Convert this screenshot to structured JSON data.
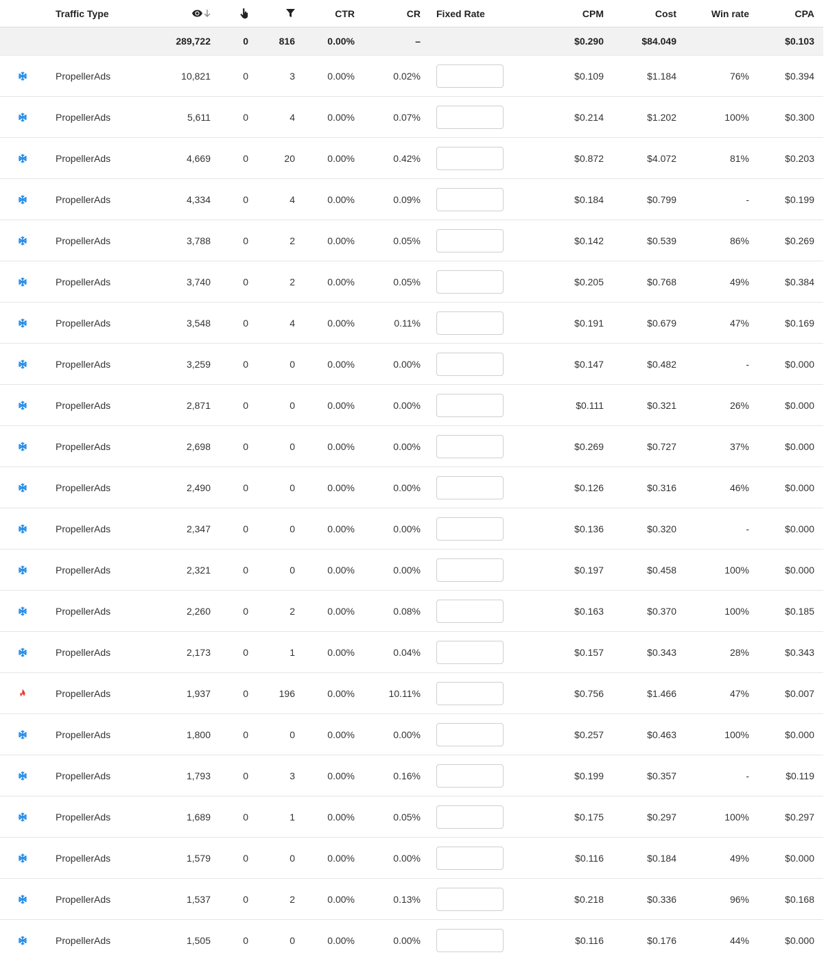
{
  "colors": {
    "snowflake": "#1e88e5",
    "fire": "#e53935",
    "total_bg": "#f2f2f2",
    "border": "#e6e6e6"
  },
  "header": {
    "traffic_type": "Traffic Type",
    "impressions_icon": "eye-icon",
    "sort_icon": "arrow-down-icon",
    "clicks_icon": "pointer-hand-icon",
    "conversions_icon": "funnel-icon",
    "ctr": "CTR",
    "cr": "CR",
    "fixed_rate": "Fixed Rate",
    "cpm": "CPM",
    "cost": "Cost",
    "win_rate": "Win rate",
    "cpa": "CPA"
  },
  "totals": {
    "impressions": "289,722",
    "clicks": "0",
    "conversions": "816",
    "ctr": "0.00%",
    "cr": "–",
    "cpm": "$0.290",
    "cost": "$84.049",
    "cpa": "$0.103"
  },
  "rows": [
    {
      "icon": "snowflake-icon",
      "type": "PropellerAds",
      "impressions": "10,821",
      "clicks": "0",
      "conversions": "3",
      "ctr": "0.00%",
      "cr": "0.02%",
      "fixed_rate": "",
      "cpm": "$0.109",
      "cost": "$1.184",
      "win_rate": "76%",
      "cpa": "$0.394"
    },
    {
      "icon": "snowflake-icon",
      "type": "PropellerAds",
      "impressions": "5,611",
      "clicks": "0",
      "conversions": "4",
      "ctr": "0.00%",
      "cr": "0.07%",
      "fixed_rate": "",
      "cpm": "$0.214",
      "cost": "$1.202",
      "win_rate": "100%",
      "cpa": "$0.300"
    },
    {
      "icon": "snowflake-icon",
      "type": "PropellerAds",
      "impressions": "4,669",
      "clicks": "0",
      "conversions": "20",
      "ctr": "0.00%",
      "cr": "0.42%",
      "fixed_rate": "",
      "cpm": "$0.872",
      "cost": "$4.072",
      "win_rate": "81%",
      "cpa": "$0.203"
    },
    {
      "icon": "snowflake-icon",
      "type": "PropellerAds",
      "impressions": "4,334",
      "clicks": "0",
      "conversions": "4",
      "ctr": "0.00%",
      "cr": "0.09%",
      "fixed_rate": "",
      "cpm": "$0.184",
      "cost": "$0.799",
      "win_rate": "-",
      "cpa": "$0.199"
    },
    {
      "icon": "snowflake-icon",
      "type": "PropellerAds",
      "impressions": "3,788",
      "clicks": "0",
      "conversions": "2",
      "ctr": "0.00%",
      "cr": "0.05%",
      "fixed_rate": "",
      "cpm": "$0.142",
      "cost": "$0.539",
      "win_rate": "86%",
      "cpa": "$0.269"
    },
    {
      "icon": "snowflake-icon",
      "type": "PropellerAds",
      "impressions": "3,740",
      "clicks": "0",
      "conversions": "2",
      "ctr": "0.00%",
      "cr": "0.05%",
      "fixed_rate": "",
      "cpm": "$0.205",
      "cost": "$0.768",
      "win_rate": "49%",
      "cpa": "$0.384"
    },
    {
      "icon": "snowflake-icon",
      "type": "PropellerAds",
      "impressions": "3,548",
      "clicks": "0",
      "conversions": "4",
      "ctr": "0.00%",
      "cr": "0.11%",
      "fixed_rate": "",
      "cpm": "$0.191",
      "cost": "$0.679",
      "win_rate": "47%",
      "cpa": "$0.169"
    },
    {
      "icon": "snowflake-icon",
      "type": "PropellerAds",
      "impressions": "3,259",
      "clicks": "0",
      "conversions": "0",
      "ctr": "0.00%",
      "cr": "0.00%",
      "fixed_rate": "",
      "cpm": "$0.147",
      "cost": "$0.482",
      "win_rate": "-",
      "cpa": "$0.000"
    },
    {
      "icon": "snowflake-icon",
      "type": "PropellerAds",
      "impressions": "2,871",
      "clicks": "0",
      "conversions": "0",
      "ctr": "0.00%",
      "cr": "0.00%",
      "fixed_rate": "",
      "cpm": "$0.111",
      "cost": "$0.321",
      "win_rate": "26%",
      "cpa": "$0.000"
    },
    {
      "icon": "snowflake-icon",
      "type": "PropellerAds",
      "impressions": "2,698",
      "clicks": "0",
      "conversions": "0",
      "ctr": "0.00%",
      "cr": "0.00%",
      "fixed_rate": "",
      "cpm": "$0.269",
      "cost": "$0.727",
      "win_rate": "37%",
      "cpa": "$0.000"
    },
    {
      "icon": "snowflake-icon",
      "type": "PropellerAds",
      "impressions": "2,490",
      "clicks": "0",
      "conversions": "0",
      "ctr": "0.00%",
      "cr": "0.00%",
      "fixed_rate": "",
      "cpm": "$0.126",
      "cost": "$0.316",
      "win_rate": "46%",
      "cpa": "$0.000"
    },
    {
      "icon": "snowflake-icon",
      "type": "PropellerAds",
      "impressions": "2,347",
      "clicks": "0",
      "conversions": "0",
      "ctr": "0.00%",
      "cr": "0.00%",
      "fixed_rate": "",
      "cpm": "$0.136",
      "cost": "$0.320",
      "win_rate": "-",
      "cpa": "$0.000"
    },
    {
      "icon": "snowflake-icon",
      "type": "PropellerAds",
      "impressions": "2,321",
      "clicks": "0",
      "conversions": "0",
      "ctr": "0.00%",
      "cr": "0.00%",
      "fixed_rate": "",
      "cpm": "$0.197",
      "cost": "$0.458",
      "win_rate": "100%",
      "cpa": "$0.000"
    },
    {
      "icon": "snowflake-icon",
      "type": "PropellerAds",
      "impressions": "2,260",
      "clicks": "0",
      "conversions": "2",
      "ctr": "0.00%",
      "cr": "0.08%",
      "fixed_rate": "",
      "cpm": "$0.163",
      "cost": "$0.370",
      "win_rate": "100%",
      "cpa": "$0.185"
    },
    {
      "icon": "snowflake-icon",
      "type": "PropellerAds",
      "impressions": "2,173",
      "clicks": "0",
      "conversions": "1",
      "ctr": "0.00%",
      "cr": "0.04%",
      "fixed_rate": "",
      "cpm": "$0.157",
      "cost": "$0.343",
      "win_rate": "28%",
      "cpa": "$0.343"
    },
    {
      "icon": "fire-icon",
      "type": "PropellerAds",
      "impressions": "1,937",
      "clicks": "0",
      "conversions": "196",
      "ctr": "0.00%",
      "cr": "10.11%",
      "fixed_rate": "",
      "cpm": "$0.756",
      "cost": "$1.466",
      "win_rate": "47%",
      "cpa": "$0.007"
    },
    {
      "icon": "snowflake-icon",
      "type": "PropellerAds",
      "impressions": "1,800",
      "clicks": "0",
      "conversions": "0",
      "ctr": "0.00%",
      "cr": "0.00%",
      "fixed_rate": "",
      "cpm": "$0.257",
      "cost": "$0.463",
      "win_rate": "100%",
      "cpa": "$0.000"
    },
    {
      "icon": "snowflake-icon",
      "type": "PropellerAds",
      "impressions": "1,793",
      "clicks": "0",
      "conversions": "3",
      "ctr": "0.00%",
      "cr": "0.16%",
      "fixed_rate": "",
      "cpm": "$0.199",
      "cost": "$0.357",
      "win_rate": "-",
      "cpa": "$0.119"
    },
    {
      "icon": "snowflake-icon",
      "type": "PropellerAds",
      "impressions": "1,689",
      "clicks": "0",
      "conversions": "1",
      "ctr": "0.00%",
      "cr": "0.05%",
      "fixed_rate": "",
      "cpm": "$0.175",
      "cost": "$0.297",
      "win_rate": "100%",
      "cpa": "$0.297"
    },
    {
      "icon": "snowflake-icon",
      "type": "PropellerAds",
      "impressions": "1,579",
      "clicks": "0",
      "conversions": "0",
      "ctr": "0.00%",
      "cr": "0.00%",
      "fixed_rate": "",
      "cpm": "$0.116",
      "cost": "$0.184",
      "win_rate": "49%",
      "cpa": "$0.000"
    },
    {
      "icon": "snowflake-icon",
      "type": "PropellerAds",
      "impressions": "1,537",
      "clicks": "0",
      "conversions": "2",
      "ctr": "0.00%",
      "cr": "0.13%",
      "fixed_rate": "",
      "cpm": "$0.218",
      "cost": "$0.336",
      "win_rate": "96%",
      "cpa": "$0.168"
    },
    {
      "icon": "snowflake-icon",
      "type": "PropellerAds",
      "impressions": "1,505",
      "clicks": "0",
      "conversions": "0",
      "ctr": "0.00%",
      "cr": "0.00%",
      "fixed_rate": "",
      "cpm": "$0.116",
      "cost": "$0.176",
      "win_rate": "44%",
      "cpa": "$0.000"
    }
  ]
}
